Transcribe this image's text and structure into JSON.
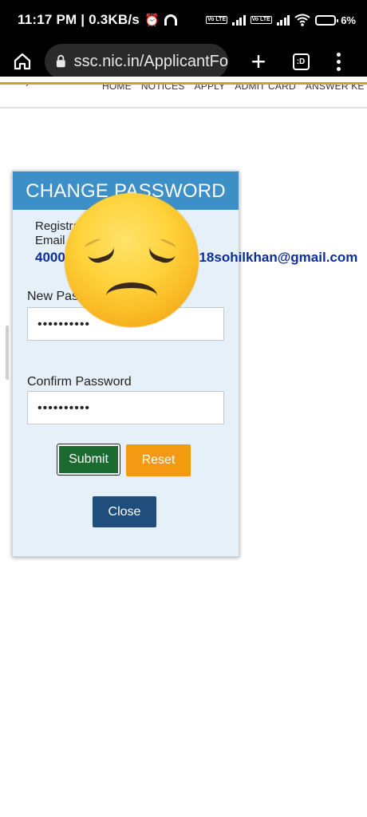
{
  "status_bar": {
    "time_speed": "11:17 PM | 0.3KB/s",
    "volte_1": "Vo LTE",
    "volte_2": "Vo LTE",
    "battery": "6%"
  },
  "browser": {
    "url": "ssc.nic.in/ApplicantFo",
    "tabs_label": ":D"
  },
  "site_nav": {
    "chevron": "›",
    "links": [
      "HOME",
      "NOTICES",
      "APPLY",
      "ADMIT CARD",
      "ANSWER KE"
    ]
  },
  "panel": {
    "title": "CHANGE PASSWORD",
    "registration_label": "Registration Id / Registered Email / Mobile No:",
    "registration_value": "4000",
    "email_value": "318sohilkhan@gmail.com",
    "new_password_label": "New Password",
    "new_password_value": "••••••••••",
    "confirm_password_label": "Confirm Password",
    "confirm_password_value": "••••••••••",
    "submit_label": "Submit",
    "reset_label": "Reset",
    "close_label": "Close"
  },
  "overlay": {
    "icon": "disappointed-face-emoji"
  }
}
